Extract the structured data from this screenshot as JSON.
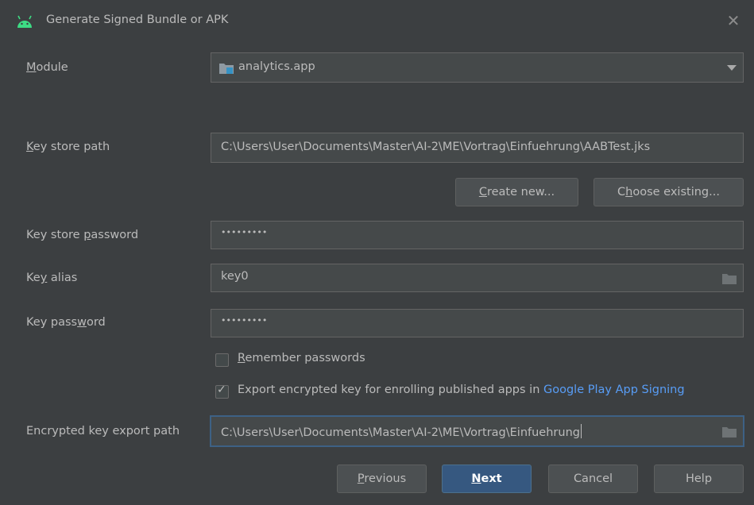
{
  "window": {
    "title": "Generate Signed Bundle or APK",
    "icon": "android-icon",
    "close_symbol": "✕"
  },
  "module": {
    "label_mnemonic": "M",
    "label_rest": "odule",
    "value": "analytics.app"
  },
  "keystore_path": {
    "label_mnemonic": "K",
    "label_rest": "ey store path",
    "value": "C:\\Users\\User\\Documents\\Master\\AI-2\\ME\\Vortrag\\Einfuehrung\\AABTest.jks"
  },
  "buttons_keystore": {
    "create_mnemonic": "C",
    "create_rest": "reate new...",
    "choose_pre": "C",
    "choose_mnemonic": "h",
    "choose_rest": "oose existing..."
  },
  "keystore_password": {
    "label_pre": "Key store ",
    "label_mnemonic": "p",
    "label_rest": "assword",
    "value": "•••••••••"
  },
  "key_alias": {
    "label_pre": "Ke",
    "label_mnemonic": "y",
    "label_rest": " alias",
    "value": "key0"
  },
  "key_password": {
    "label_pre": "Key pass",
    "label_mnemonic": "w",
    "label_rest": "ord",
    "value": "•••••••••"
  },
  "remember": {
    "checked": false,
    "label_mnemonic": "R",
    "label_rest": "emember passwords"
  },
  "export": {
    "checked": true,
    "check_symbol": "✓",
    "label": "Export encrypted key for enrolling published apps in ",
    "link": "Google Play App Signing"
  },
  "export_path": {
    "label": "Encrypted key export path",
    "value": "C:\\Users\\User\\Documents\\Master\\AI-2\\ME\\Vortrag\\Einfuehrung"
  },
  "footer": {
    "previous_mnemonic": "P",
    "previous_rest": "revious",
    "next_mnemonic": "N",
    "next_rest": "ext",
    "cancel": "Cancel",
    "help": "Help"
  },
  "colors": {
    "background": "#3c3f41",
    "field": "#45494a",
    "default_button": "#365880",
    "link": "#589df6",
    "focus_border": "#3d6185"
  }
}
